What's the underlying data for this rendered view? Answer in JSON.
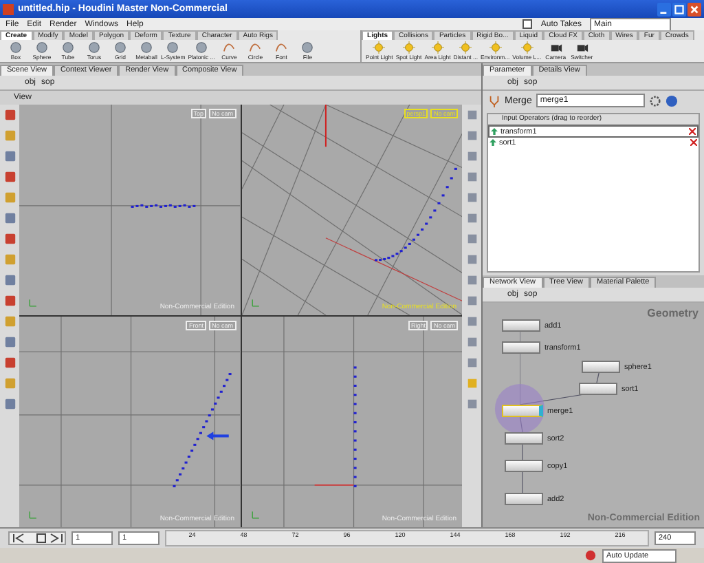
{
  "window": {
    "title": "untitled.hip - Houdini Master Non-Commercial"
  },
  "menu": [
    "File",
    "Edit",
    "Render",
    "Windows",
    "Help"
  ],
  "auto_takes": {
    "label": "Auto Takes",
    "checked": false
  },
  "take": "Main",
  "shelf_left": {
    "tabs": [
      {
        "label": "Create",
        "selected": true
      },
      {
        "label": "Modify",
        "selected": false
      },
      {
        "label": "Model",
        "selected": false
      },
      {
        "label": "Polygon",
        "selected": false
      },
      {
        "label": "Deform",
        "selected": false
      },
      {
        "label": "Texture",
        "selected": false
      },
      {
        "label": "Character",
        "selected": false
      },
      {
        "label": "Auto Rigs",
        "selected": false
      }
    ],
    "tools": [
      {
        "label": "Box",
        "kind": "solid"
      },
      {
        "label": "Sphere",
        "kind": "solid"
      },
      {
        "label": "Tube",
        "kind": "solid"
      },
      {
        "label": "Torus",
        "kind": "solid"
      },
      {
        "label": "Grid",
        "kind": "solid"
      },
      {
        "label": "Metaball",
        "kind": "solid"
      },
      {
        "label": "L-System",
        "kind": "solid"
      },
      {
        "label": "Platonic ...",
        "kind": "solid"
      },
      {
        "label": "Curve",
        "kind": "curve"
      },
      {
        "label": "Circle",
        "kind": "curve"
      },
      {
        "label": "Font",
        "kind": "curve"
      },
      {
        "label": "File",
        "kind": "solid"
      }
    ]
  },
  "shelf_right": {
    "tabs": [
      {
        "label": "Lights",
        "selected": true
      },
      {
        "label": "Collisions",
        "selected": false
      },
      {
        "label": "Particles",
        "selected": false
      },
      {
        "label": "Rigid Bo...",
        "selected": false
      },
      {
        "label": "Liquid",
        "selected": false
      },
      {
        "label": "Cloud FX",
        "selected": false
      },
      {
        "label": "Cloth",
        "selected": false
      },
      {
        "label": "Wires",
        "selected": false
      },
      {
        "label": "Fur",
        "selected": false
      },
      {
        "label": "Crowds",
        "selected": false
      }
    ],
    "tools": [
      {
        "label": "Point Light",
        "kind": "light"
      },
      {
        "label": "Spot Light",
        "kind": "light"
      },
      {
        "label": "Area Light",
        "kind": "light"
      },
      {
        "label": "Distant ...",
        "kind": "light"
      },
      {
        "label": "Environm...",
        "kind": "light"
      },
      {
        "label": "Volume L...",
        "kind": "light"
      },
      {
        "label": "Camera",
        "kind": "camera"
      },
      {
        "label": "Switcher",
        "kind": "camera"
      }
    ]
  },
  "viewer": {
    "tabs": [
      {
        "label": "Scene View",
        "selected": true
      },
      {
        "label": "Context Viewer",
        "selected": false
      },
      {
        "label": "Render View",
        "selected": false
      },
      {
        "label": "Composite View",
        "selected": false
      }
    ],
    "path": [
      "obj",
      "sop"
    ],
    "title": "View",
    "viewports": [
      {
        "kind": "top",
        "camera": "Top",
        "mode": "No cam",
        "watermark": "Non-Commercial Edition"
      },
      {
        "kind": "persp",
        "camera": "persp1",
        "mode": "No cam",
        "watermark": "Non-Commercial Edition"
      },
      {
        "kind": "front",
        "camera": "Front",
        "mode": "No cam",
        "watermark": "Non-Commercial Edition"
      },
      {
        "kind": "right",
        "camera": "Right",
        "mode": "No cam",
        "watermark": "Non-Commercial Edition"
      }
    ]
  },
  "parameters": {
    "tabs": [
      {
        "label": "Parameter",
        "selected": true
      },
      {
        "label": "Details View",
        "selected": false
      }
    ],
    "path": [
      "obj",
      "sop"
    ],
    "node_type": "Merge",
    "node_name": "merge1",
    "table_header": "Input Operators (drag to reorder)",
    "inputs": [
      {
        "name": "transform1",
        "selected": true
      },
      {
        "name": "sort1",
        "selected": false
      }
    ]
  },
  "network": {
    "tabs": [
      {
        "label": "Network View",
        "selected": true
      },
      {
        "label": "Tree View",
        "selected": false
      },
      {
        "label": "Material Palette",
        "selected": false
      }
    ],
    "path": [
      "obj",
      "sop"
    ],
    "context": "Geometry",
    "watermark": "Non-Commercial Edition",
    "nodes": [
      {
        "name": "add1",
        "selected": false,
        "display": false
      },
      {
        "name": "transform1",
        "selected": false,
        "display": false
      },
      {
        "name": "sphere1",
        "selected": false,
        "display": false
      },
      {
        "name": "sort1",
        "selected": false,
        "display": false
      },
      {
        "name": "merge1",
        "selected": true,
        "display": true
      },
      {
        "name": "sort2",
        "selected": false,
        "display": false
      },
      {
        "name": "copy1",
        "selected": false,
        "display": false
      },
      {
        "name": "add2",
        "selected": false,
        "display": false
      }
    ]
  },
  "timeline": {
    "start": "1",
    "frame": "1",
    "ticks": [
      "24",
      "48",
      "72",
      "96",
      "120",
      "144",
      "168",
      "192",
      "216"
    ],
    "end": "240"
  },
  "status": {
    "update": "Auto Update"
  }
}
